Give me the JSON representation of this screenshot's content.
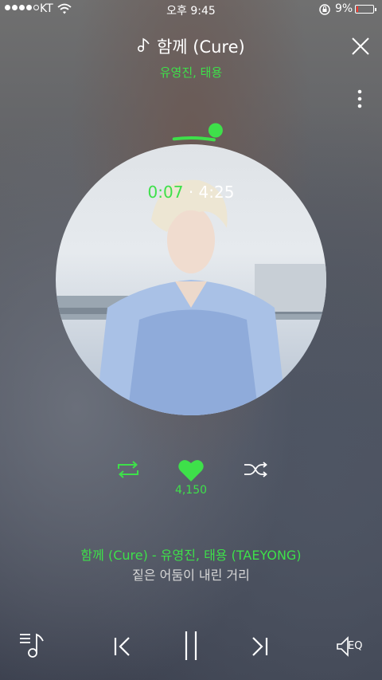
{
  "status_bar": {
    "carrier": "KT",
    "time": "오후 9:45",
    "battery_pct": "9%",
    "battery_level": 0.09,
    "battery_color": "#ff3b30"
  },
  "header": {
    "title": "함께 (Cure)",
    "artists": "유영진, 태용",
    "title_icon": "music-note-icon",
    "close_icon": "close-icon",
    "more_icon": "more-vertical-icon"
  },
  "player": {
    "elapsed": "0:07",
    "separator": "·",
    "duration": "4:25",
    "progress": 0.026,
    "likes": "4,150",
    "accent_color": "#3ee04a"
  },
  "lyrics": {
    "song_line": "함께 (Cure) - 유영진, 태용 (TAEYONG)",
    "current_line": "짙은 어둠이 내린 거리"
  },
  "controls": {
    "repeat_icon": "repeat-icon",
    "like_icon": "heart-icon",
    "shuffle_icon": "shuffle-icon",
    "playlist_icon": "playlist-icon",
    "prev_icon": "previous-icon",
    "pause_icon": "pause-icon",
    "next_icon": "next-icon",
    "eq_icon": "speaker-icon",
    "eq_label": "EQ"
  }
}
